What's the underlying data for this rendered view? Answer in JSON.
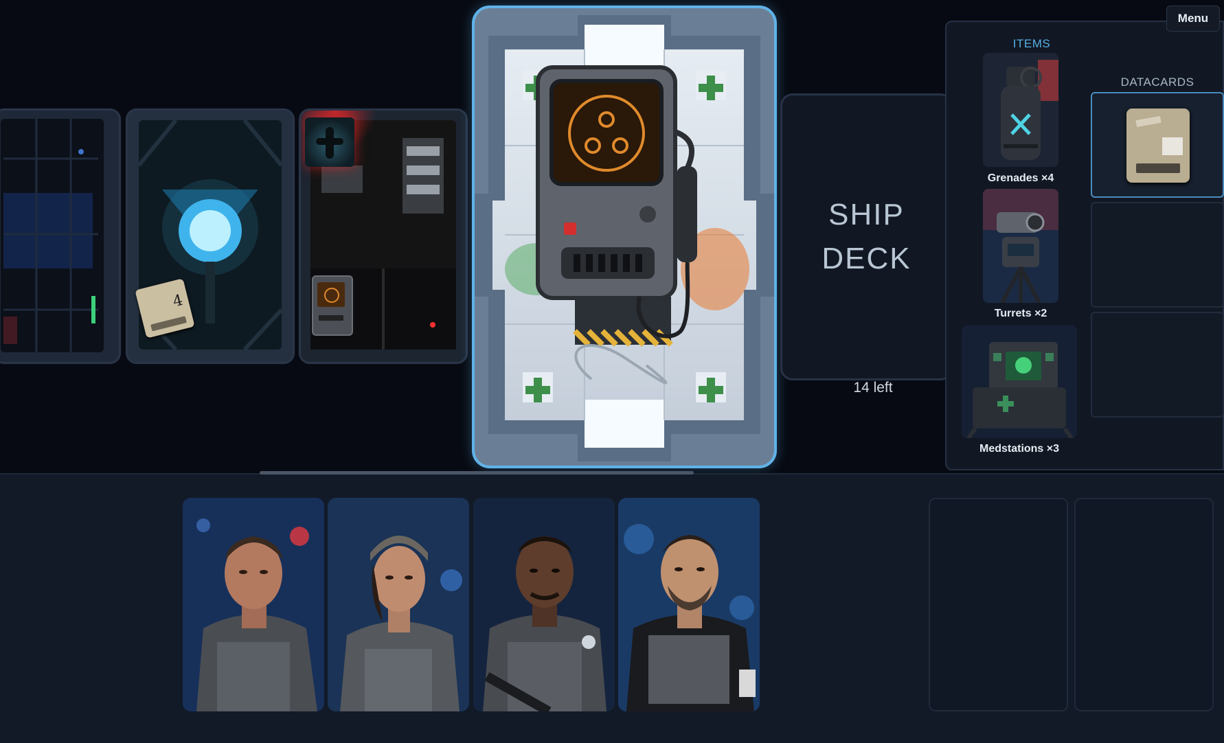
{
  "menu": {
    "label": "Menu"
  },
  "board": {
    "rooms": [
      {
        "name": "room-tile-corridor",
        "icon": "corridor-room"
      },
      {
        "name": "room-tile-reactor",
        "icon": "reactor-room",
        "badge": "4"
      },
      {
        "name": "room-tile-infested",
        "icon": "infested-room"
      }
    ],
    "featured_card": {
      "icon": "scanner-device-on-medbay-room"
    }
  },
  "deck": {
    "line1": "SHIP",
    "line2": "DECK",
    "count_text": "14 left"
  },
  "inventory": {
    "items_heading": "ITEMS",
    "items": [
      {
        "label": "Grenades ×4",
        "icon": "grenade-icon"
      },
      {
        "label": "Turrets ×2",
        "icon": "turret-icon"
      },
      {
        "label": "Medstations ×3",
        "icon": "medstation-icon"
      }
    ],
    "datacards_heading": "DATACARDS",
    "datacards": [
      {
        "icon": "datacard-icon",
        "state": "filled"
      },
      {
        "state": "empty"
      },
      {
        "state": "empty"
      }
    ]
  },
  "crew": [
    {
      "icon": "marine-portrait-1"
    },
    {
      "icon": "marine-portrait-2"
    },
    {
      "icon": "marine-portrait-3"
    },
    {
      "icon": "marine-portrait-4"
    }
  ],
  "colors": {
    "accent": "#5fb2e8",
    "items_heading": "#59aee3",
    "scanner_screen": "#e08a2c"
  }
}
